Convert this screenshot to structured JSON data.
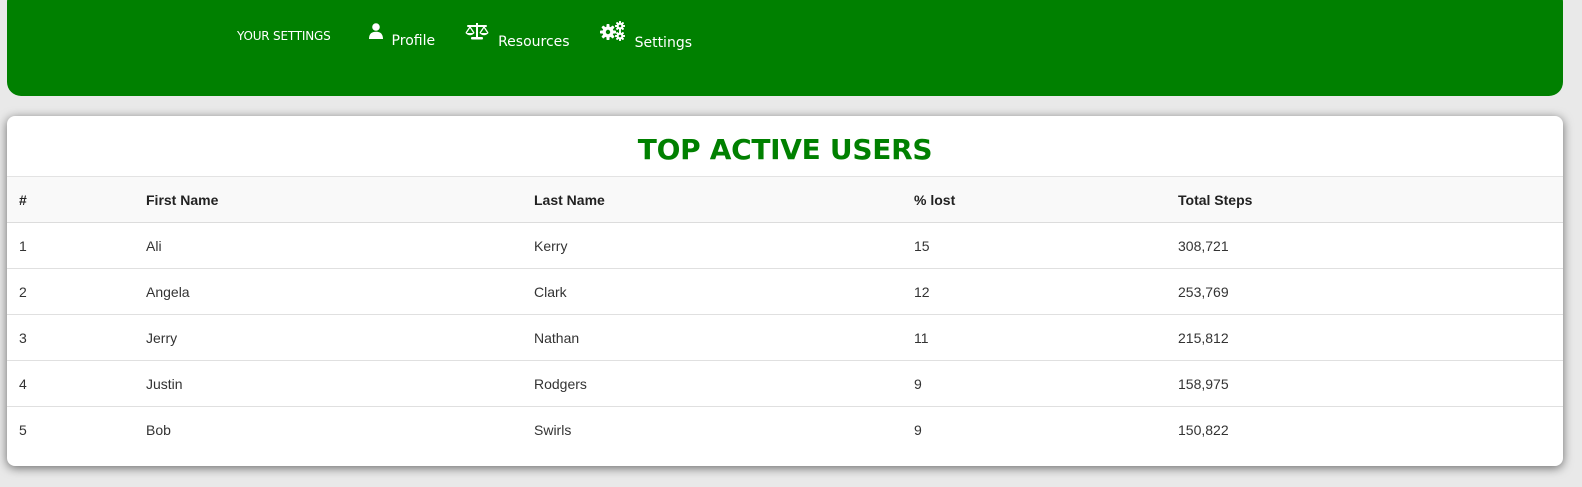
{
  "nav": {
    "brand": "YOUR SETTINGS",
    "items": [
      {
        "label": "Profile",
        "icon": "user-icon"
      },
      {
        "label": "Resources",
        "icon": "scale-icon"
      },
      {
        "label": "Settings",
        "icon": "gears-icon"
      }
    ]
  },
  "colors": {
    "brand_green": "#008000",
    "background": "#e9e9e9"
  },
  "table": {
    "title": "TOP ACTIVE USERS",
    "columns": [
      "#",
      "First Name",
      "Last Name",
      "% lost",
      "Total Steps"
    ],
    "rows": [
      [
        "1",
        "Ali",
        "Kerry",
        "15",
        "308,721"
      ],
      [
        "2",
        "Angela",
        "Clark",
        "12",
        "253,769"
      ],
      [
        "3",
        "Jerry",
        "Nathan",
        "11",
        "215,812"
      ],
      [
        "4",
        "Justin",
        "Rodgers",
        "9",
        "158,975"
      ],
      [
        "5",
        "Bob",
        "Swirls",
        "9",
        "150,822"
      ]
    ]
  }
}
